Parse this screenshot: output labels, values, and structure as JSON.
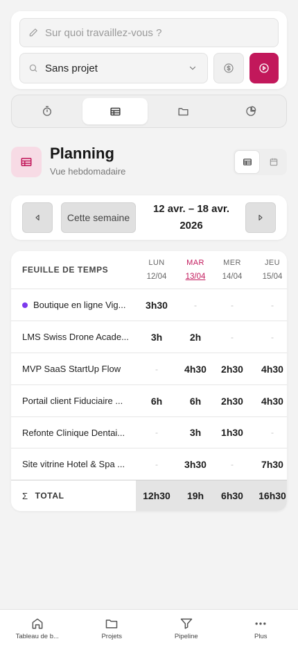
{
  "entry": {
    "task_placeholder": "Sur quoi travaillez-vous ?",
    "project_value": "Sans projet"
  },
  "tabs": [
    {
      "icon": "stopwatch-icon",
      "active": false
    },
    {
      "icon": "table-icon",
      "active": true
    },
    {
      "icon": "folder-icon",
      "active": false
    },
    {
      "icon": "pie-chart-icon",
      "active": false
    }
  ],
  "header": {
    "title": "Planning",
    "subtitle": "Vue hebdomadaire"
  },
  "week_nav": {
    "this_week_label": "Cette semaine",
    "range_line1": "12 avr. – 18 avr.",
    "range_line2": "2026"
  },
  "timesheet": {
    "label": "FEUILLE DE TEMPS",
    "days": [
      {
        "name": "LUN",
        "date": "12/04",
        "today": false
      },
      {
        "name": "MAR",
        "date": "13/04",
        "today": true
      },
      {
        "name": "MER",
        "date": "14/04",
        "today": false
      },
      {
        "name": "JEU",
        "date": "15/04",
        "today": false
      }
    ],
    "rows": [
      {
        "project": "Boutique en ligne Vig...",
        "dot": true,
        "values": [
          "3h30",
          "-",
          "-",
          "-"
        ]
      },
      {
        "project": "LMS Swiss Drone Acade...",
        "dot": false,
        "values": [
          "3h",
          "2h",
          "-",
          "-"
        ]
      },
      {
        "project": "MVP SaaS StartUp Flow",
        "dot": false,
        "values": [
          "-",
          "4h30",
          "2h30",
          "4h30"
        ]
      },
      {
        "project": "Portail client Fiduciaire ...",
        "dot": false,
        "values": [
          "6h",
          "6h",
          "2h30",
          "4h30"
        ]
      },
      {
        "project": "Refonte Clinique Dentai...",
        "dot": false,
        "values": [
          "-",
          "3h",
          "1h30",
          "-"
        ]
      },
      {
        "project": "Site vitrine Hotel & Spa ...",
        "dot": false,
        "values": [
          "-",
          "3h30",
          "-",
          "7h30"
        ]
      }
    ],
    "total_symbol": "Σ",
    "total_label": "TOTAL",
    "totals": [
      "12h30",
      "19h",
      "6h30",
      "16h30"
    ]
  },
  "bottom_nav": [
    {
      "label": "Tableau de b...",
      "icon": "home-icon"
    },
    {
      "label": "Projets",
      "icon": "folder-icon"
    },
    {
      "label": "Pipeline",
      "icon": "filter-icon"
    },
    {
      "label": "Plus",
      "icon": "more-icon"
    }
  ],
  "colors": {
    "accent": "#c2185b",
    "project_dot": "#7c3aed"
  }
}
